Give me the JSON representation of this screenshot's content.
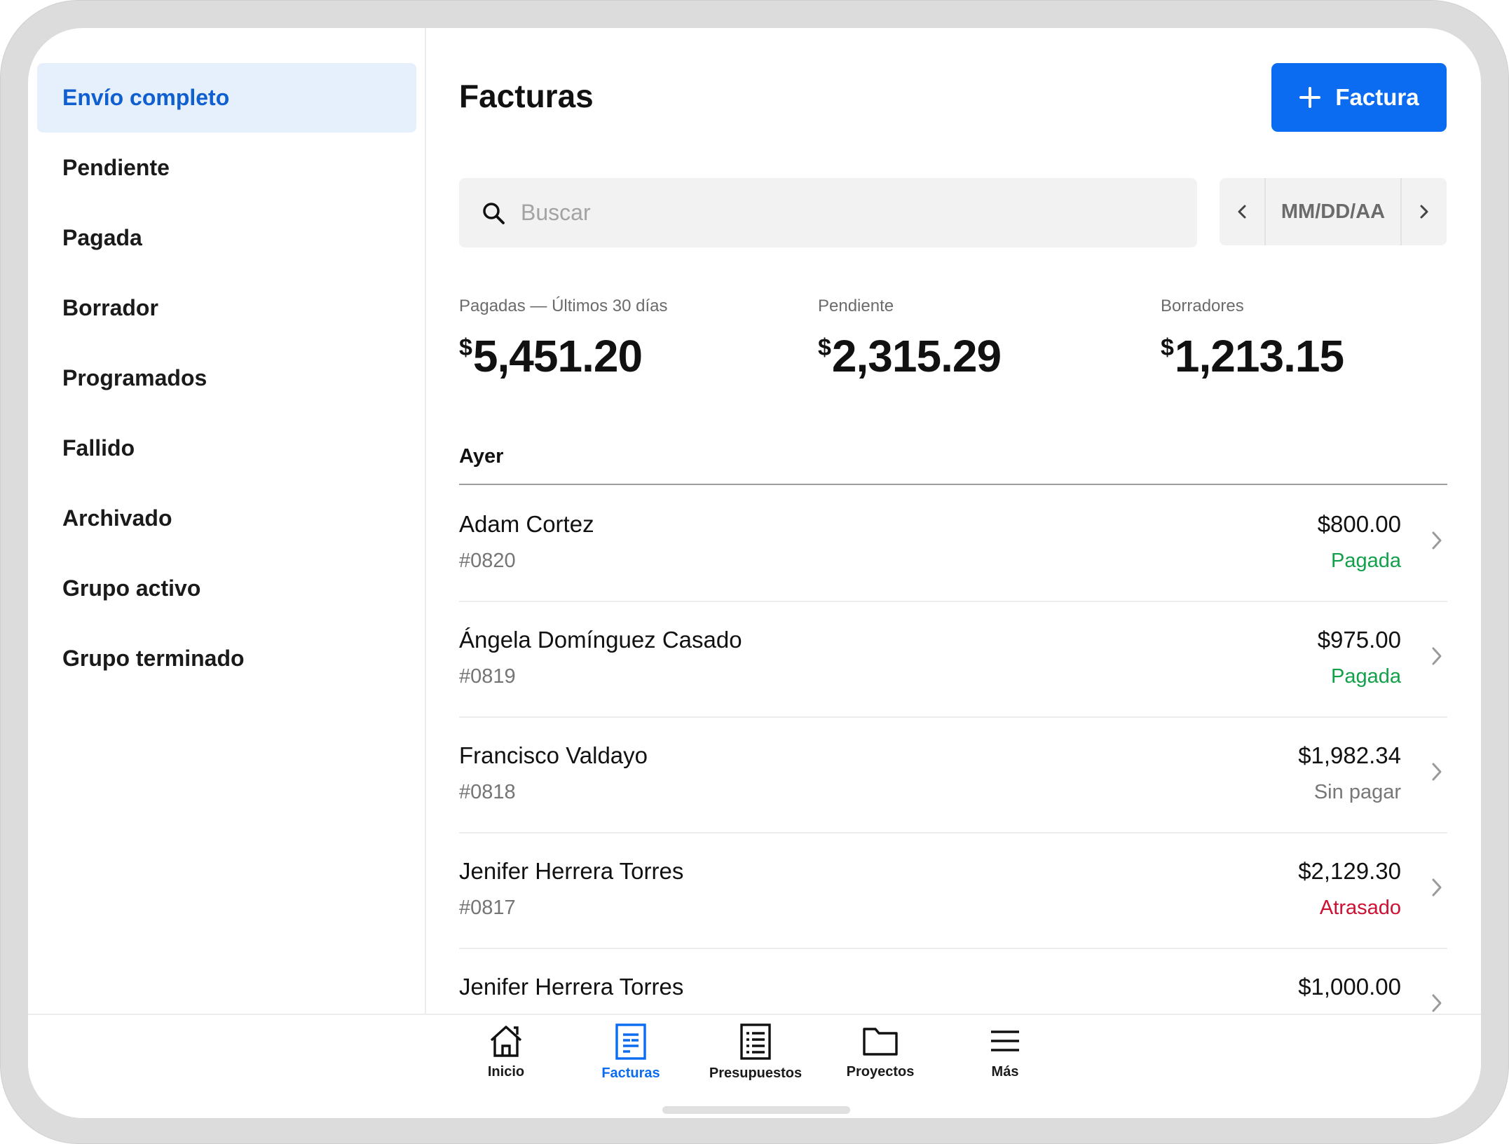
{
  "sidebar": {
    "items": [
      {
        "label": "Envío completo",
        "active": true
      },
      {
        "label": "Pendiente"
      },
      {
        "label": "Pagada"
      },
      {
        "label": "Borrador"
      },
      {
        "label": "Programados"
      },
      {
        "label": "Fallido"
      },
      {
        "label": "Archivado"
      },
      {
        "label": "Grupo activo"
      },
      {
        "label": "Grupo terminado"
      }
    ]
  },
  "header": {
    "title": "Facturas",
    "new_button_label": "Factura"
  },
  "search": {
    "placeholder": "Buscar"
  },
  "date_picker": {
    "value": "MM/DD/AA"
  },
  "stats": [
    {
      "label": "Pagadas — Últimos 30 días",
      "currency": "$",
      "amount": "5,451.20"
    },
    {
      "label": "Pendiente",
      "currency": "$",
      "amount": "2,315.29"
    },
    {
      "label": "Borradores",
      "currency": "$",
      "amount": "1,213.15"
    }
  ],
  "section_label": "Ayer",
  "invoices": [
    {
      "name": "Adam Cortez",
      "number": "#0820",
      "amount": "$800.00",
      "status": "Pagada",
      "status_color": "#12a14a"
    },
    {
      "name": "Ángela Domínguez Casado",
      "number": "#0819",
      "amount": "$975.00",
      "status": "Pagada",
      "status_color": "#12a14a"
    },
    {
      "name": "Francisco Valdayo",
      "number": "#0818",
      "amount": "$1,982.34",
      "status": "Sin pagar",
      "status_color": "#777777"
    },
    {
      "name": "Jenifer Herrera Torres",
      "number": "#0817",
      "amount": "$2,129.30",
      "status": "Atrasado",
      "status_color": "#cc1133"
    },
    {
      "name": "Jenifer Herrera Torres",
      "number": "",
      "amount": "$1,000.00",
      "status": "",
      "status_color": "#777777"
    }
  ],
  "tabs": [
    {
      "label": "Inicio",
      "icon": "home-icon"
    },
    {
      "label": "Facturas",
      "icon": "invoice-icon",
      "active": true
    },
    {
      "label": "Presupuestos",
      "icon": "estimate-icon"
    },
    {
      "label": "Proyectos",
      "icon": "folder-icon"
    },
    {
      "label": "Más",
      "icon": "menu-icon"
    }
  ],
  "colors": {
    "accent": "#0b6cf2",
    "active_nav_bg": "#e6f0fd",
    "active_nav_text": "#0f5fd1",
    "paid": "#12a14a",
    "overdue": "#cc1133"
  }
}
